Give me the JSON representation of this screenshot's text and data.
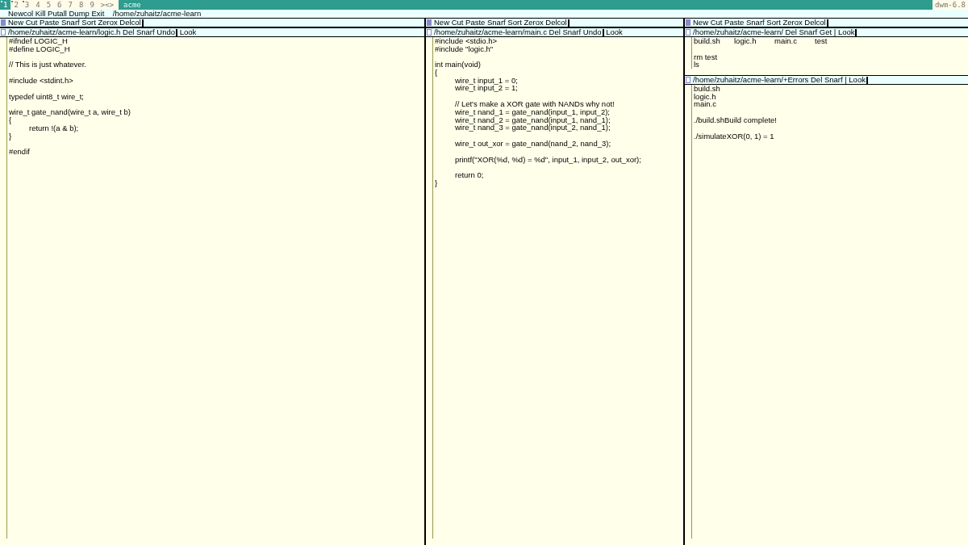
{
  "bar": {
    "tags": [
      {
        "label": "1",
        "selected": true,
        "occupied": true
      },
      {
        "label": "2",
        "selected": false,
        "occupied": true
      },
      {
        "label": "3",
        "selected": false,
        "occupied": true
      },
      {
        "label": "4",
        "selected": false,
        "occupied": false
      },
      {
        "label": "5",
        "selected": false,
        "occupied": false
      },
      {
        "label": "6",
        "selected": false,
        "occupied": false
      },
      {
        "label": "7",
        "selected": false,
        "occupied": false
      },
      {
        "label": "8",
        "selected": false,
        "occupied": false
      },
      {
        "label": "9",
        "selected": false,
        "occupied": false
      }
    ],
    "layout": "><>",
    "title": "acme",
    "status": "dwm-6.8"
  },
  "acme": {
    "tag": "Newcol Kill Putall Dump Exit    /home/zuhaitz/acme-learn",
    "columns": [
      {
        "tag": "New Cut Paste Snarf Sort Zerox Delcol",
        "windows": [
          {
            "tag": "/home/zuhaitz/acme-learn/logic.h Del Snarf Undo",
            "tag_rest": " Look",
            "dirty": false,
            "blocks": [
              [
                "#ifndef LOGIC_H",
                "#define LOGIC_H"
              ],
              [
                "// This is just whatever."
              ],
              [
                "#include <stdint.h>"
              ],
              [
                "typedef uint8_t wire_t;"
              ],
              [
                "wire_t gate_nand(wire_t a, wire_t b)",
                "{",
                "\treturn !(a & b);",
                "}"
              ],
              [
                "#endif"
              ]
            ]
          }
        ]
      },
      {
        "tag": "New Cut Paste Snarf Sort Zerox Delcol",
        "windows": [
          {
            "tag": "/home/zuhaitz/acme-learn/main.c Del Snarf Undo",
            "tag_rest": " Look",
            "dirty": false,
            "blocks": [
              [
                "#include <stdio.h>",
                "#include \"logic.h\""
              ],
              [
                "int main(void)",
                "{",
                "\twire_t input_1 = 0;",
                "\twire_t input_2 = 1;"
              ],
              [
                "\t// Let's make a XOR gate with NANDs why not!",
                "\twire_t nand_1 = gate_nand(input_1, input_2);",
                "\twire_t nand_2 = gate_nand(input_1, nand_1);",
                "\twire_t nand_3 = gate_nand(input_2, nand_1);"
              ],
              [
                "\twire_t out_xor = gate_nand(nand_2, nand_3);"
              ],
              [
                "\tprintf(\"XOR(%d, %d) = %d\", input_1, input_2, out_xor);"
              ],
              [
                "\treturn 0;",
                "}"
              ]
            ]
          }
        ]
      },
      {
        "tag": "New Cut Paste Snarf Sort Zerox Delcol",
        "windows": [
          {
            "tag": "/home/zuhaitz/acme-learn/ Del Snarf Get | Look",
            "dirty": false,
            "blocks": [
              [
                "build.sh\tlogic.h\tmain.c\ttest"
              ],
              [
                "rm test",
                "ls"
              ]
            ]
          },
          {
            "tag": "/home/zuhaitz/acme-learn/+Errors Del Snarf | Look",
            "dirty": false,
            "blocks": [
              [
                "build.sh",
                "logic.h",
                "main.c"
              ],
              [
                "./build.shBuild complete!"
              ],
              [
                "./simulateXOR(0, 1) = 1"
              ]
            ]
          }
        ]
      }
    ]
  }
}
